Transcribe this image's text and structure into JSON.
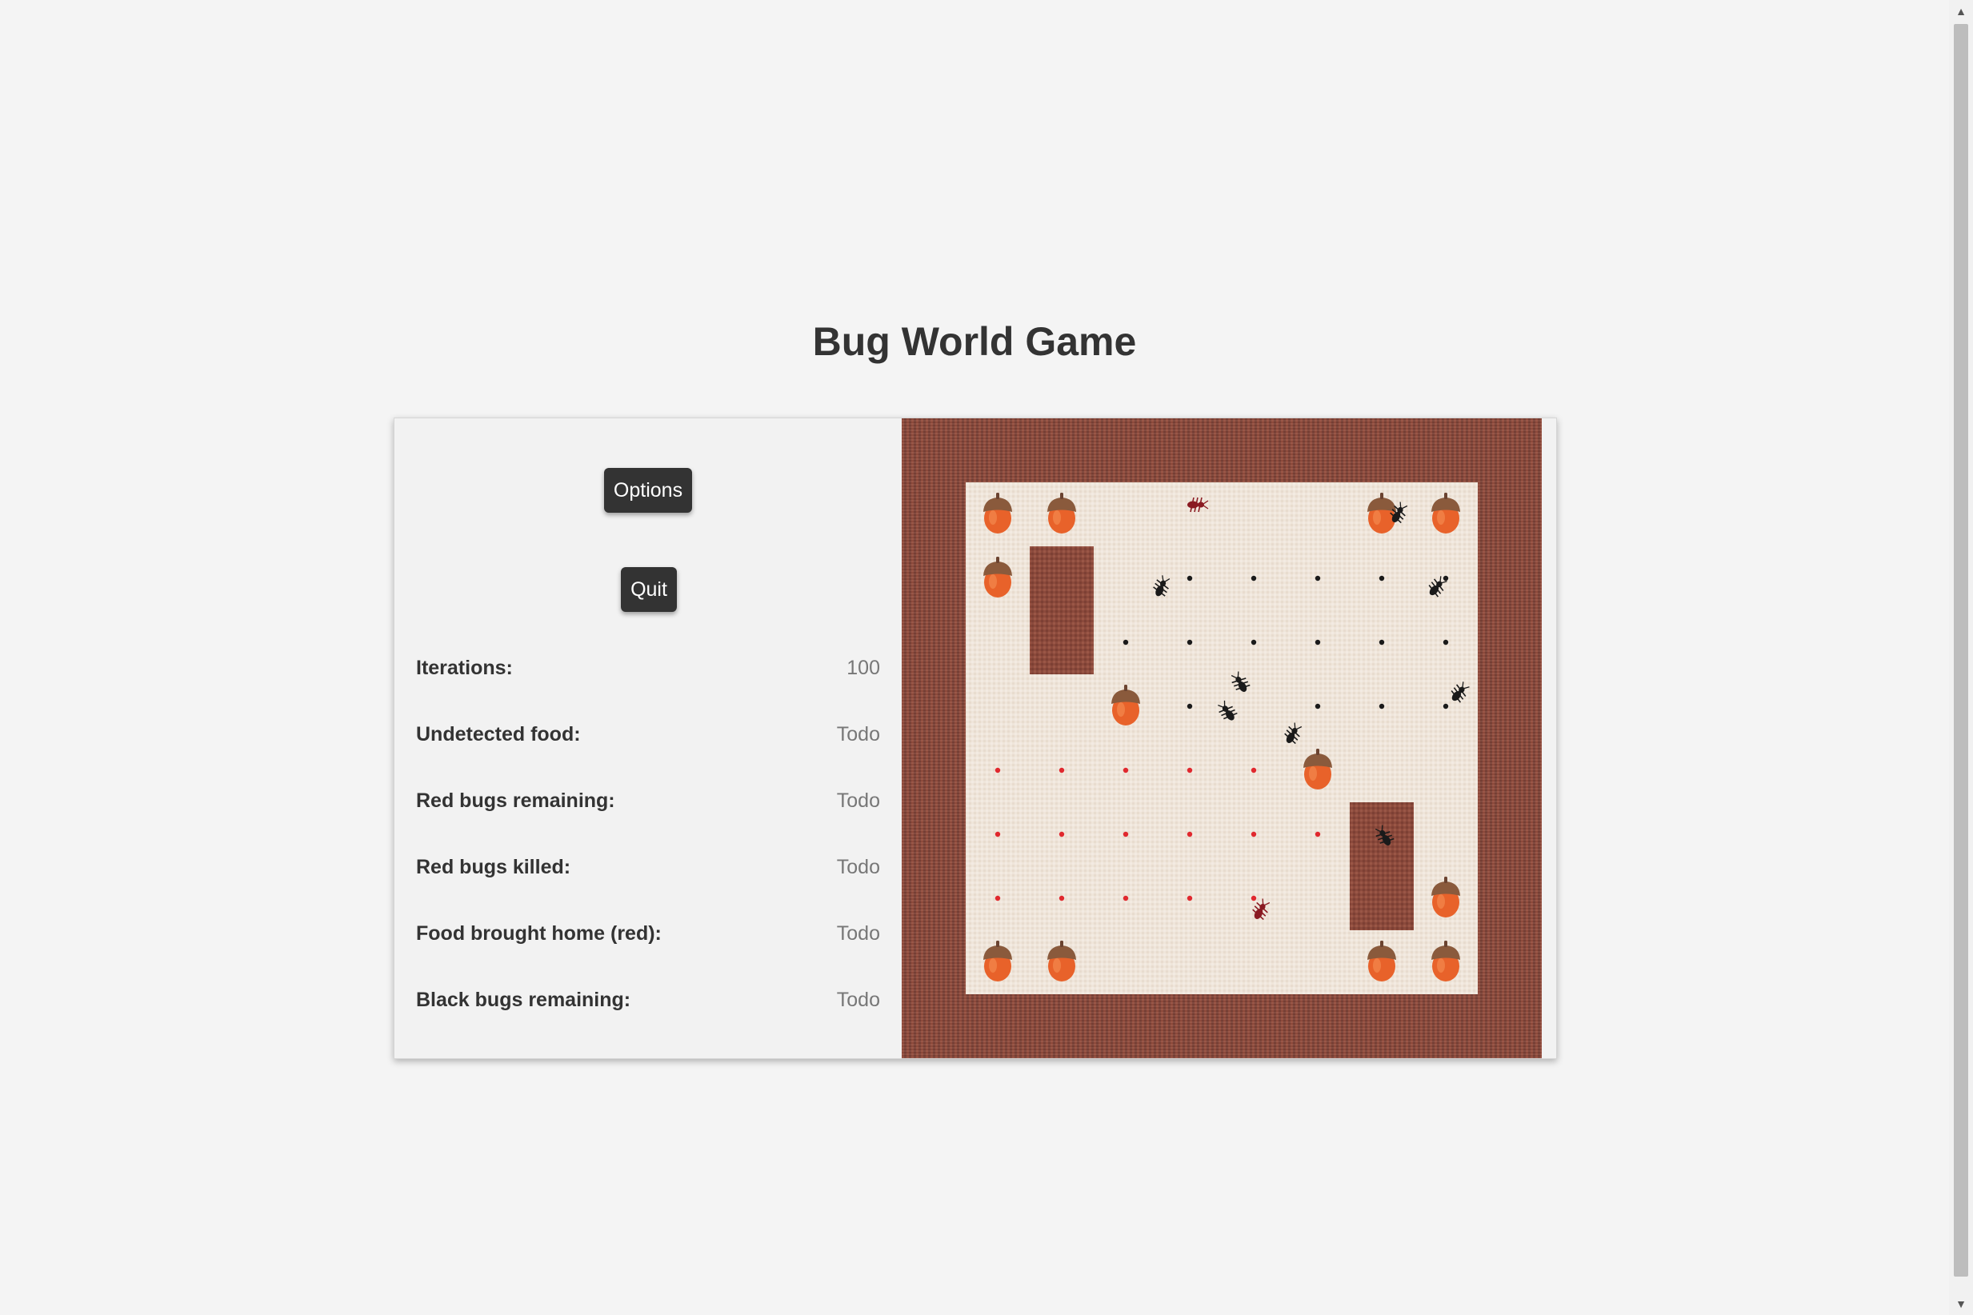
{
  "title": "Bug World Game",
  "controls": {
    "options_label": "Options",
    "quit_label": "Quit"
  },
  "stats": [
    {
      "label": "Iterations:",
      "value": "100"
    },
    {
      "label": "Undetected food:",
      "value": "Todo"
    },
    {
      "label": "Red bugs remaining:",
      "value": "Todo"
    },
    {
      "label": "Red bugs killed:",
      "value": "Todo"
    },
    {
      "label": "Food brought home (red):",
      "value": "Todo"
    },
    {
      "label": "Black bugs remaining:",
      "value": "Todo"
    }
  ],
  "world": {
    "grid_size": 8,
    "border_color": "#8a4a3c",
    "floor_color": "#efe5da",
    "obstacle_color": "#8b4a3c",
    "acorn_color": "#e8622a",
    "red_color": "#e0282e",
    "black_color": "#1a1a1a",
    "obstacles": [
      {
        "col": 1,
        "row": 1,
        "cols": 1,
        "rows": 2
      },
      {
        "col": 6,
        "row": 5,
        "cols": 1,
        "rows": 2
      }
    ],
    "food": [
      {
        "col": 0,
        "row": 0
      },
      {
        "col": 1,
        "row": 0
      },
      {
        "col": 6,
        "row": 0
      },
      {
        "col": 7,
        "row": 0
      },
      {
        "col": 0,
        "row": 1
      },
      {
        "col": 2,
        "row": 3
      },
      {
        "col": 5,
        "row": 4
      },
      {
        "col": 7,
        "row": 6
      },
      {
        "col": 0,
        "row": 7
      },
      {
        "col": 1,
        "row": 7
      },
      {
        "col": 6,
        "row": 7
      },
      {
        "col": 7,
        "row": 7
      }
    ],
    "black_nest": [
      {
        "col": 3,
        "row": 1
      },
      {
        "col": 4,
        "row": 1
      },
      {
        "col": 5,
        "row": 1
      },
      {
        "col": 6,
        "row": 1
      },
      {
        "col": 7,
        "row": 1
      },
      {
        "col": 2,
        "row": 2
      },
      {
        "col": 3,
        "row": 2
      },
      {
        "col": 4,
        "row": 2
      },
      {
        "col": 5,
        "row": 2
      },
      {
        "col": 6,
        "row": 2
      },
      {
        "col": 7,
        "row": 2
      },
      {
        "col": 3,
        "row": 3
      },
      {
        "col": 5,
        "row": 3
      },
      {
        "col": 6,
        "row": 3
      },
      {
        "col": 7,
        "row": 3
      }
    ],
    "red_nest": [
      {
        "col": 0,
        "row": 4
      },
      {
        "col": 1,
        "row": 4
      },
      {
        "col": 2,
        "row": 4
      },
      {
        "col": 3,
        "row": 4
      },
      {
        "col": 4,
        "row": 4
      },
      {
        "col": 0,
        "row": 5
      },
      {
        "col": 1,
        "row": 5
      },
      {
        "col": 2,
        "row": 5
      },
      {
        "col": 3,
        "row": 5
      },
      {
        "col": 4,
        "row": 5
      },
      {
        "col": 5,
        "row": 5
      },
      {
        "col": 0,
        "row": 6
      },
      {
        "col": 1,
        "row": 6
      },
      {
        "col": 2,
        "row": 6
      },
      {
        "col": 3,
        "row": 6
      },
      {
        "col": 4,
        "row": 6
      }
    ],
    "bugs": [
      {
        "color": "red",
        "col": 3.6,
        "row": 0.35,
        "angle": 90
      },
      {
        "color": "red",
        "col": 4.6,
        "row": 6.7,
        "angle": 30
      },
      {
        "color": "black",
        "col": 6.75,
        "row": 0.5,
        "angle": 30
      },
      {
        "color": "black",
        "col": 3.05,
        "row": 1.65,
        "angle": 25
      },
      {
        "color": "black",
        "col": 7.35,
        "row": 1.65,
        "angle": 40
      },
      {
        "color": "black",
        "col": 4.3,
        "row": 3.15,
        "angle": -30
      },
      {
        "color": "black",
        "col": 4.1,
        "row": 3.6,
        "angle": -35
      },
      {
        "color": "black",
        "col": 7.7,
        "row": 3.3,
        "angle": 40
      },
      {
        "color": "black",
        "col": 5.1,
        "row": 3.95,
        "angle": 30
      },
      {
        "color": "black",
        "col": 6.55,
        "row": 5.55,
        "angle": -30
      }
    ]
  }
}
